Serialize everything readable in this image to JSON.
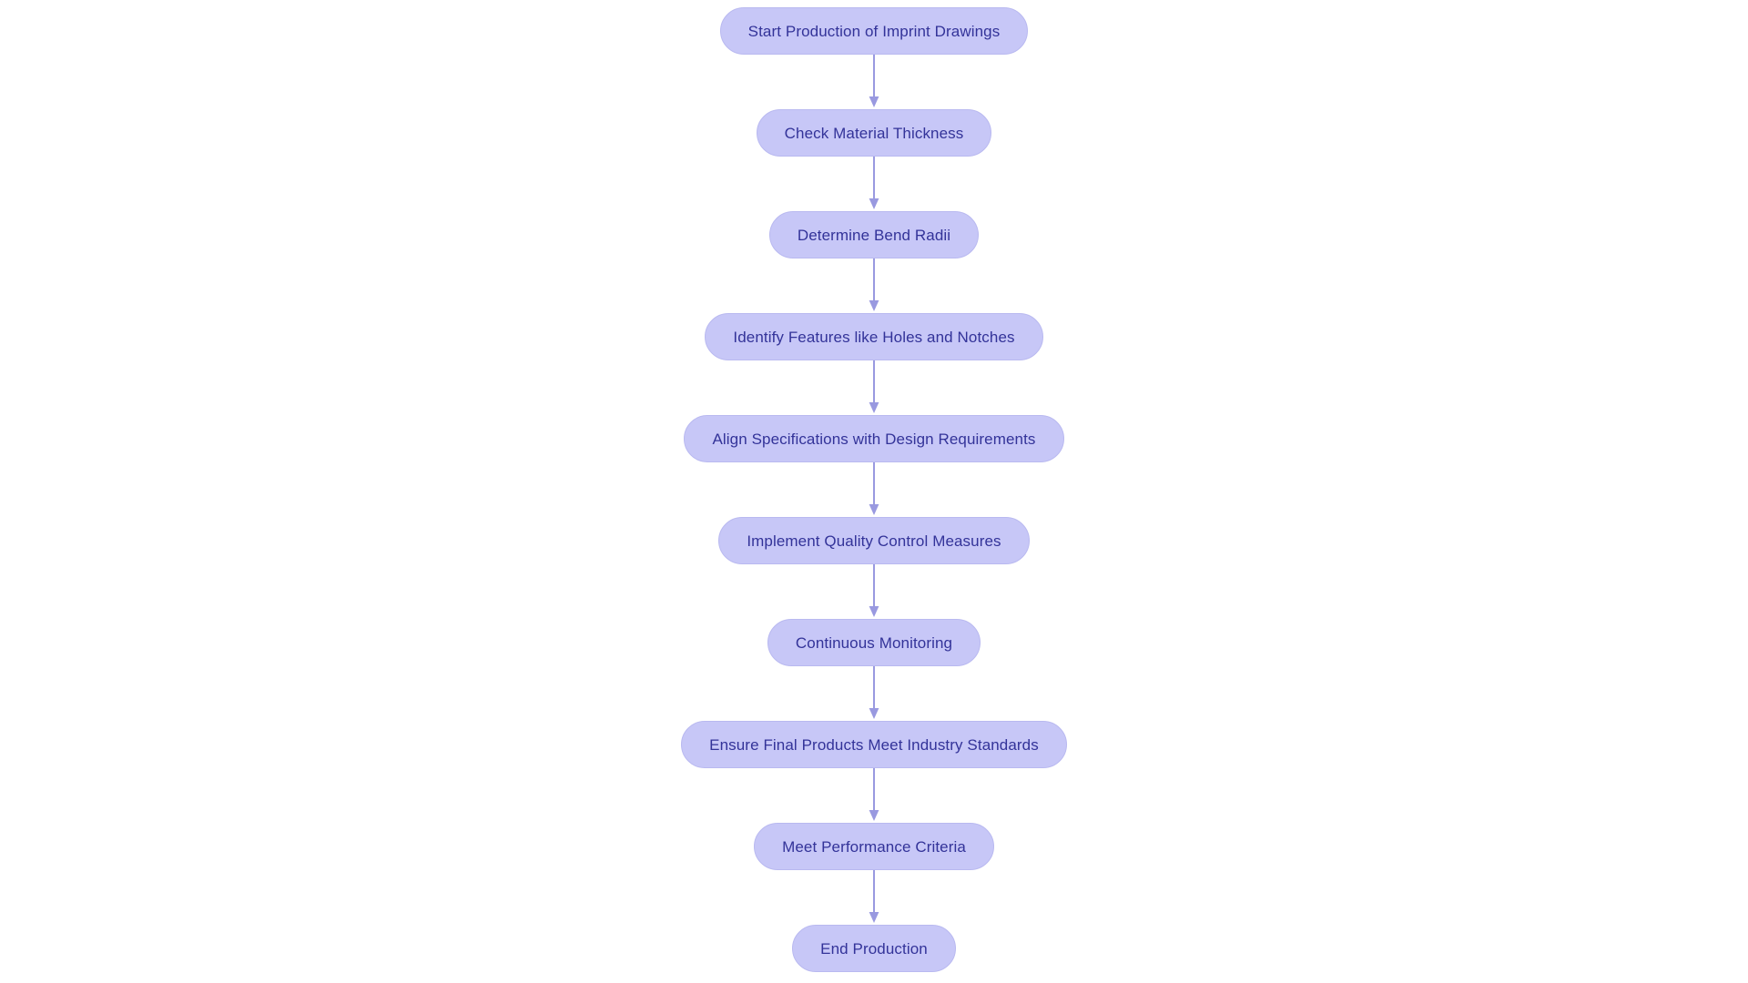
{
  "diagram": {
    "type": "flowchart",
    "orientation": "top-to-bottom",
    "background_color": "#ffffff",
    "node_fill_color": "#c7c7f7",
    "node_border_color": "#b9b9f0",
    "node_text_color": "#333399",
    "connector_color": "#9999e0",
    "node_shape": "stadium",
    "nodes": [
      {
        "id": "n1",
        "label": "Start Production of Imprint Drawings"
      },
      {
        "id": "n2",
        "label": "Check Material Thickness"
      },
      {
        "id": "n3",
        "label": "Determine Bend Radii"
      },
      {
        "id": "n4",
        "label": "Identify Features like Holes and Notches"
      },
      {
        "id": "n5",
        "label": "Align Specifications with Design Requirements"
      },
      {
        "id": "n6",
        "label": "Implement Quality Control Measures"
      },
      {
        "id": "n7",
        "label": "Continuous Monitoring"
      },
      {
        "id": "n8",
        "label": "Ensure Final Products Meet Industry Standards"
      },
      {
        "id": "n9",
        "label": "Meet Performance Criteria"
      },
      {
        "id": "n10",
        "label": "End Production"
      }
    ],
    "edges": [
      {
        "from": "n1",
        "to": "n2",
        "label": ""
      },
      {
        "from": "n2",
        "to": "n3",
        "label": ""
      },
      {
        "from": "n3",
        "to": "n4",
        "label": ""
      },
      {
        "from": "n4",
        "to": "n5",
        "label": ""
      },
      {
        "from": "n5",
        "to": "n6",
        "label": ""
      },
      {
        "from": "n6",
        "to": "n7",
        "label": ""
      },
      {
        "from": "n7",
        "to": "n8",
        "label": ""
      },
      {
        "from": "n8",
        "to": "n9",
        "label": ""
      },
      {
        "from": "n9",
        "to": "n10",
        "label": ""
      }
    ]
  }
}
